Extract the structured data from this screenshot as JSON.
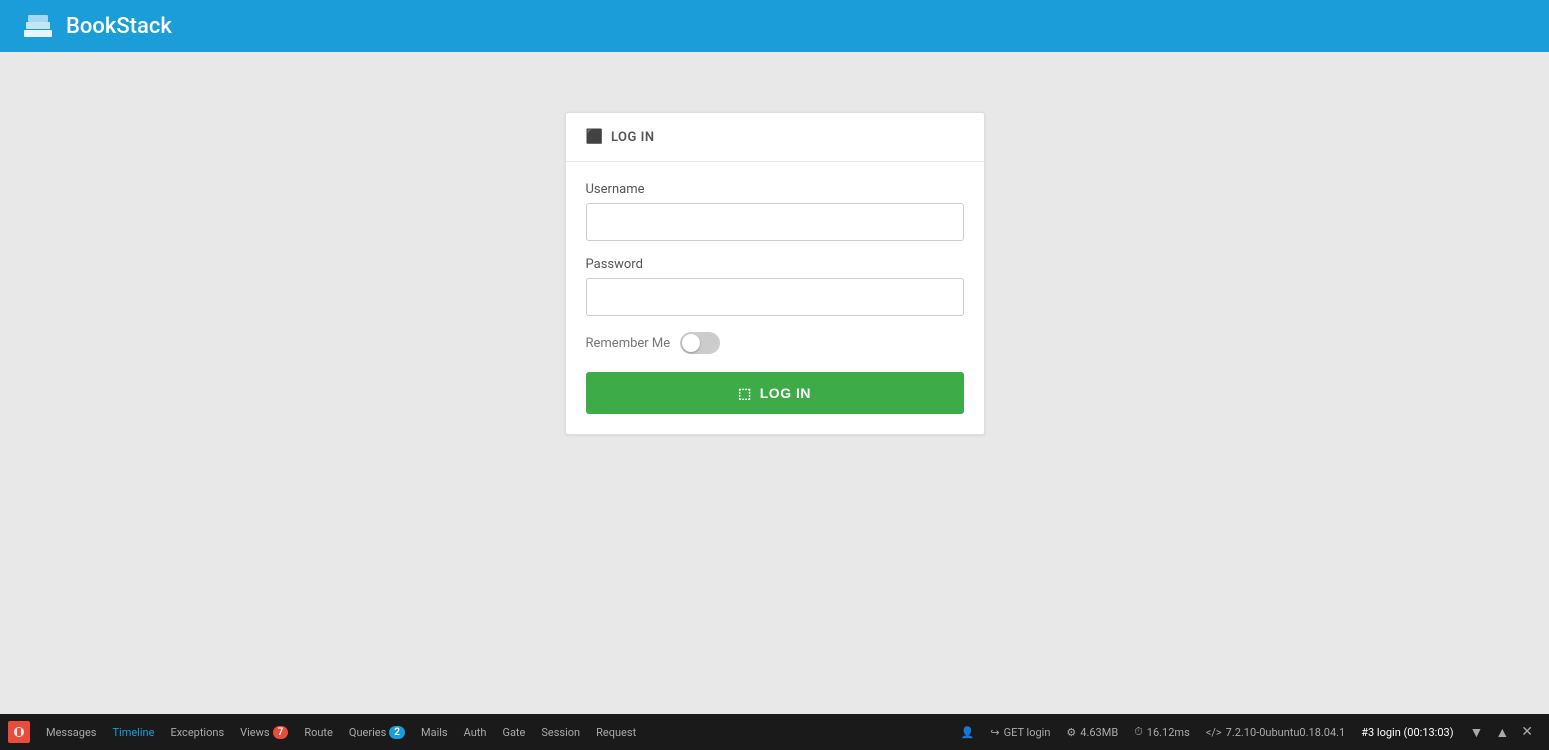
{
  "header": {
    "title": "BookStack",
    "logo_alt": "BookStack logo"
  },
  "login_card": {
    "title": "LOG IN",
    "username_label": "Username",
    "username_placeholder": "",
    "password_label": "Password",
    "password_placeholder": "",
    "remember_me_label": "Remember Me",
    "remember_me_checked": false,
    "login_button_label": "LOG IN"
  },
  "debug_bar": {
    "items": [
      {
        "label": "Messages",
        "badge": null,
        "color": "default"
      },
      {
        "label": "Timeline",
        "badge": null,
        "color": "default"
      },
      {
        "label": "Exceptions",
        "badge": null,
        "color": "default"
      },
      {
        "label": "Views",
        "badge": "7",
        "badge_color": "red"
      },
      {
        "label": "Route",
        "badge": null,
        "color": "default"
      },
      {
        "label": "Queries",
        "badge": "2",
        "badge_color": "blue"
      },
      {
        "label": "Mails",
        "badge": null,
        "color": "default"
      },
      {
        "label": "Auth",
        "badge": null,
        "color": "default"
      },
      {
        "label": "Gate",
        "badge": null,
        "color": "default"
      },
      {
        "label": "Session",
        "badge": null,
        "color": "default"
      },
      {
        "label": "Request",
        "badge": null,
        "color": "default"
      }
    ],
    "right_items": [
      {
        "icon": "user",
        "value": ""
      },
      {
        "icon": "route",
        "value": "GET login"
      },
      {
        "icon": "memory",
        "value": "4.63MB"
      },
      {
        "icon": "clock",
        "value": "16.12ms"
      },
      {
        "icon": "php",
        "value": "7.2.10-0ubuntu0.18.04.1"
      },
      {
        "icon": "hash",
        "value": "#3 login (00:13:03)"
      }
    ]
  }
}
